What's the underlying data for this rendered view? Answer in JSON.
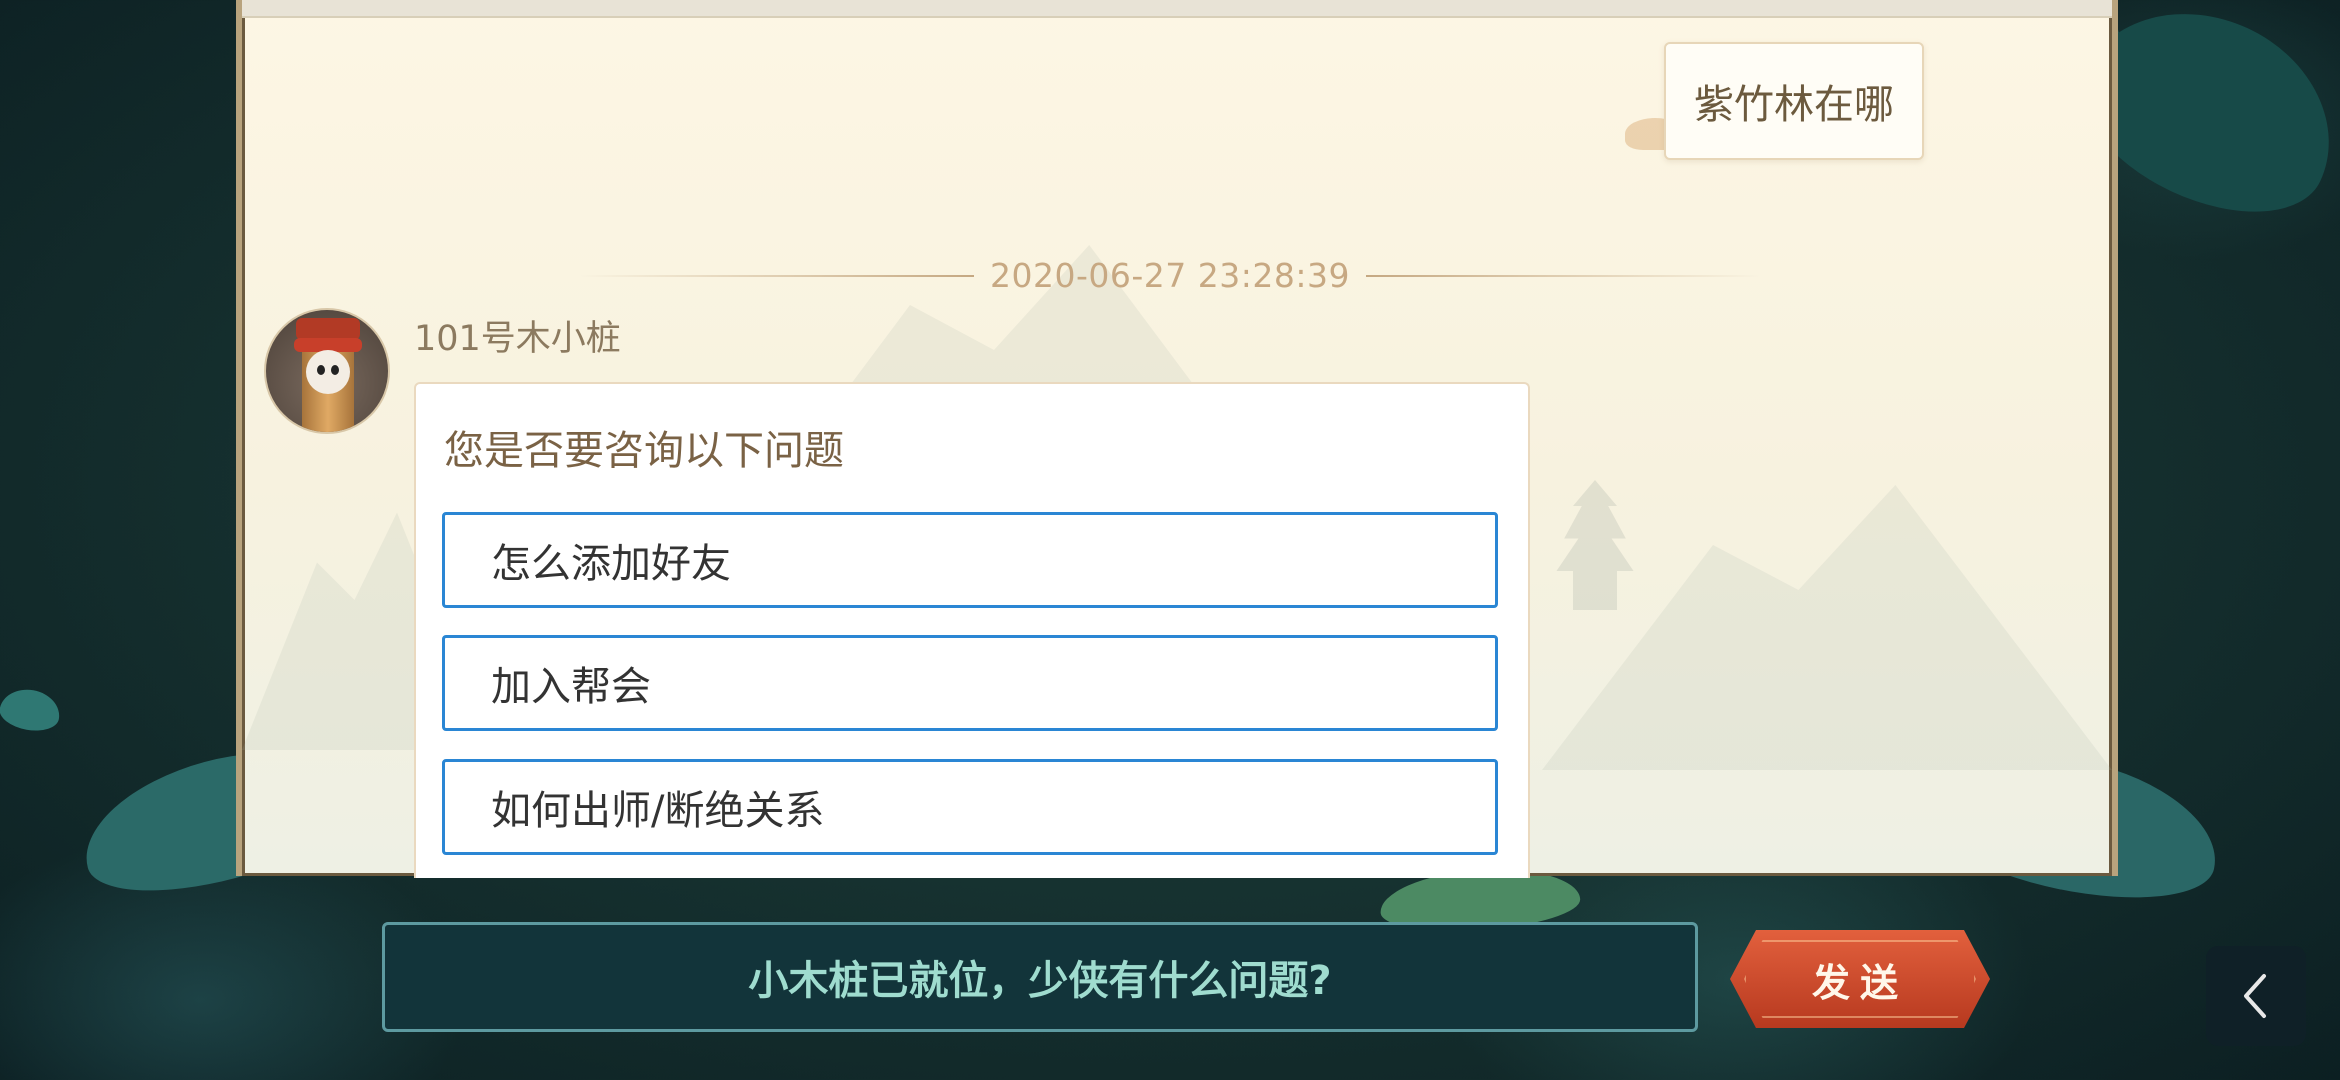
{
  "chat": {
    "user_message": "紫竹林在哪",
    "timestamp": "2020-06-27 23:28:39",
    "bot_name": "101号木小桩",
    "bot_question": "您是否要咨询以下问题",
    "options": [
      {
        "label": "怎么添加好友"
      },
      {
        "label": "加入帮会"
      },
      {
        "label": "如何出师/断绝关系"
      }
    ]
  },
  "input": {
    "prompt": "小木桩已就位，少侠有什么问题?"
  },
  "send_button": {
    "label": "发送"
  },
  "icons": {
    "back": "chevron-left-icon",
    "avatar": "wooden-stump-mascot"
  },
  "colors": {
    "option_border": "#2a86d4",
    "send_button": "#c9452a",
    "input_bg": "#12343a",
    "input_text": "#9fdccf",
    "timestamp": "#c7a882"
  }
}
